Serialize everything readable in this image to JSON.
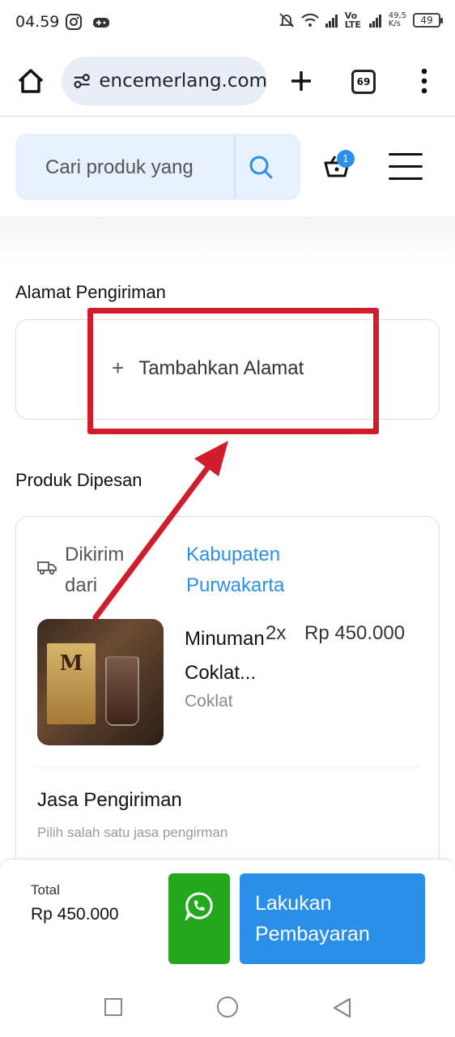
{
  "status_bar": {
    "time": "04.59",
    "network_type": "Vo LTE",
    "speed": "49,5",
    "speed_unit": "K/s",
    "battery": "49"
  },
  "browser": {
    "url": "encemerlang.com",
    "tab_count": "69"
  },
  "shop_header": {
    "search_placeholder": "Cari produk yang",
    "cart_count": "1"
  },
  "address": {
    "section_title": "Alamat Pengiriman",
    "add_label": "Tambahkan Alamat",
    "add_symbol": "+"
  },
  "order": {
    "section_title": "Produk Dipesan",
    "ship_from_label": "Dikirim dari",
    "ship_from_city": "Kabupaten Purwakarta",
    "product": {
      "name": "Minuman Coklat...",
      "quantity": "2x",
      "price": "Rp 450.000",
      "variant": "Coklat",
      "brand_letter": "M"
    },
    "shipping_service_title": "Jasa Pengiriman",
    "shipping_service_hint": "Pilih salah satu jasa pengirman"
  },
  "checkout": {
    "total_label": "Total",
    "total_value": "Rp 450.000",
    "pay_label": "Lakukan Pembayaran"
  },
  "colors": {
    "accent": "#2a8fe8",
    "whatsapp": "#23a71c",
    "annotation_red": "#d01d2b",
    "search_bg": "#e6f1fd"
  }
}
